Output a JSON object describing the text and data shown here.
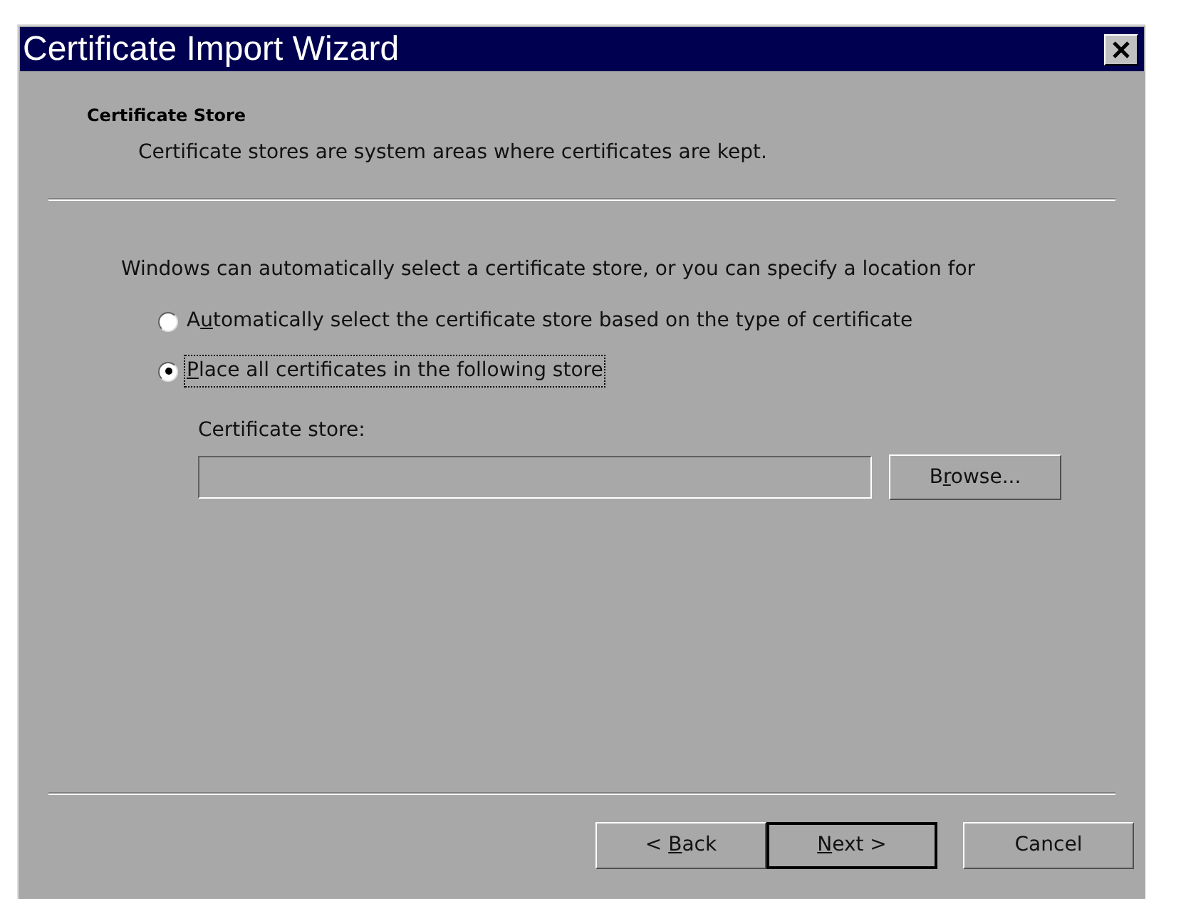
{
  "window": {
    "title": "Certificate Import Wizard"
  },
  "header": {
    "title": "Certificate Store",
    "subtitle": "Certificate stores are system areas where certificates are kept."
  },
  "intro": "Windows can automatically select a certificate store, or you can specify a location for",
  "options": [
    {
      "label": {
        "before": "A",
        "key": "u",
        "after": "tomatically select the certificate store based on the type of certificate"
      },
      "selected": false,
      "focused": false
    },
    {
      "label": {
        "key": "P",
        "after": "lace all certificates in the following store"
      },
      "selected": true,
      "focused": true
    }
  ],
  "store_field": {
    "label": "Certificate store:",
    "disabled": true
  },
  "browse_button": {
    "label": {
      "before": "B",
      "key": "r",
      "after": "owse..."
    }
  },
  "buttons": [
    {
      "label": {
        "before": "< ",
        "key": "B",
        "after": "ack"
      },
      "default": false
    },
    {
      "label": {
        "key": "N",
        "after": "ext >"
      },
      "default": true
    },
    {
      "label": {
        "before": "Cancel"
      },
      "default": false
    }
  ]
}
